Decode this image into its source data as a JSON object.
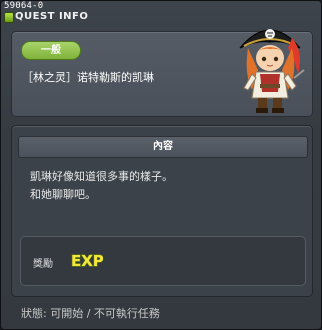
{
  "window": {
    "quest_id": "59064-0",
    "title": "QUEST INFO"
  },
  "header": {
    "category_badge": "一般",
    "npc_name": "［林之灵］诺特勒斯的凯琳"
  },
  "content": {
    "header": "內容",
    "lines": [
      "凱琳好像知道很多事的樣子。",
      "和她聊聊吧。"
    ]
  },
  "reward": {
    "label": "獎勵",
    "exp_text": "EXP"
  },
  "status": {
    "text": "狀態: 可開始 / 不可執行任務"
  },
  "colors": {
    "badge_green": "#8cc04a",
    "exp_yellow": "#f5e63a"
  }
}
